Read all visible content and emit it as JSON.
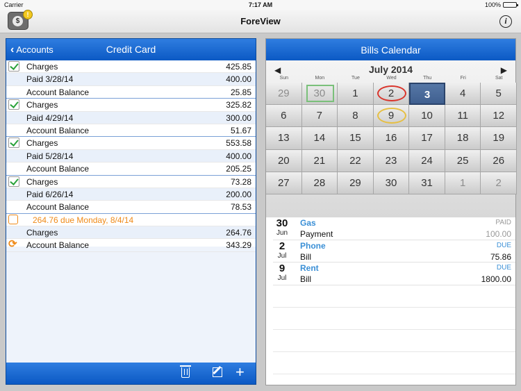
{
  "status_bar": {
    "carrier": "Carrier",
    "time": "7:17 AM",
    "battery": "100%"
  },
  "nav": {
    "title": "ForeView",
    "badge": "!",
    "coin": "$",
    "info": "i"
  },
  "left": {
    "back_label": "Accounts",
    "title": "Credit Card",
    "rows": [
      {
        "icon": "check",
        "label": "Charges",
        "value": "425.85",
        "alt": false
      },
      {
        "icon": "",
        "label": "Paid 3/28/14",
        "value": "400.00",
        "alt": true
      },
      {
        "icon": "",
        "label": "Account Balance",
        "value": "25.85",
        "alt": false,
        "end": true
      },
      {
        "icon": "check",
        "label": "Charges",
        "value": "325.82",
        "alt": false
      },
      {
        "icon": "",
        "label": "Paid 4/29/14",
        "value": "300.00",
        "alt": true
      },
      {
        "icon": "",
        "label": "Account Balance",
        "value": "51.67",
        "alt": false,
        "end": true
      },
      {
        "icon": "check",
        "label": "Charges",
        "value": "553.58",
        "alt": false
      },
      {
        "icon": "",
        "label": "Paid 5/28/14",
        "value": "400.00",
        "alt": true
      },
      {
        "icon": "",
        "label": "Account Balance",
        "value": "205.25",
        "alt": false,
        "end": true
      },
      {
        "icon": "check",
        "label": "Charges",
        "value": "73.28",
        "alt": false
      },
      {
        "icon": "",
        "label": "Paid 6/26/14",
        "value": "200.00",
        "alt": true
      },
      {
        "icon": "",
        "label": "Account Balance",
        "value": "78.53",
        "alt": false,
        "end": true
      },
      {
        "icon": "empty",
        "label": "",
        "due": "264.76 due Monday, 8/4/14",
        "value": "",
        "alt": false
      },
      {
        "icon": "",
        "label": "Charges",
        "value": "264.76",
        "alt": true
      },
      {
        "icon": "refresh",
        "label": "Account Balance",
        "value": "343.29",
        "alt": false
      }
    ]
  },
  "right": {
    "title": "Bills Calendar",
    "month": "July 2014",
    "prev": "◀",
    "next": "▶",
    "dows": [
      "Sun",
      "Mon",
      "Tue",
      "Wed",
      "Thu",
      "Fri",
      "Sat"
    ],
    "days": [
      {
        "d": "29",
        "other": true
      },
      {
        "d": "30",
        "other": true,
        "mark": "box"
      },
      {
        "d": "1"
      },
      {
        "d": "2",
        "mark": "red"
      },
      {
        "d": "3",
        "today": true
      },
      {
        "d": "4"
      },
      {
        "d": "5"
      },
      {
        "d": "6"
      },
      {
        "d": "7"
      },
      {
        "d": "8"
      },
      {
        "d": "9",
        "mark": "yellow"
      },
      {
        "d": "10"
      },
      {
        "d": "11"
      },
      {
        "d": "12"
      },
      {
        "d": "13"
      },
      {
        "d": "14"
      },
      {
        "d": "15"
      },
      {
        "d": "16"
      },
      {
        "d": "17"
      },
      {
        "d": "18"
      },
      {
        "d": "19"
      },
      {
        "d": "20"
      },
      {
        "d": "21"
      },
      {
        "d": "22"
      },
      {
        "d": "23"
      },
      {
        "d": "24"
      },
      {
        "d": "25"
      },
      {
        "d": "26"
      },
      {
        "d": "27"
      },
      {
        "d": "28"
      },
      {
        "d": "29"
      },
      {
        "d": "30"
      },
      {
        "d": "31"
      },
      {
        "d": "1",
        "other": true
      },
      {
        "d": "2",
        "other": true
      }
    ],
    "bills": [
      {
        "day": "30",
        "month": "Jun",
        "name": "Gas",
        "status": "PAID",
        "type": "Payment",
        "amount": "100.00",
        "paid": true
      },
      {
        "day": "2",
        "month": "Jul",
        "name": "Phone",
        "status": "DUE",
        "type": "Bill",
        "amount": "75.86",
        "paid": false
      },
      {
        "day": "9",
        "month": "Jul",
        "name": "Rent",
        "status": "DUE",
        "type": "Bill",
        "amount": "1800.00",
        "paid": false
      }
    ]
  },
  "colors": {
    "accent_blue": "#0b59c4",
    "due_orange": "#ef8a18",
    "check_green": "#2aa23a",
    "today_blue": "#4a6a9a"
  }
}
